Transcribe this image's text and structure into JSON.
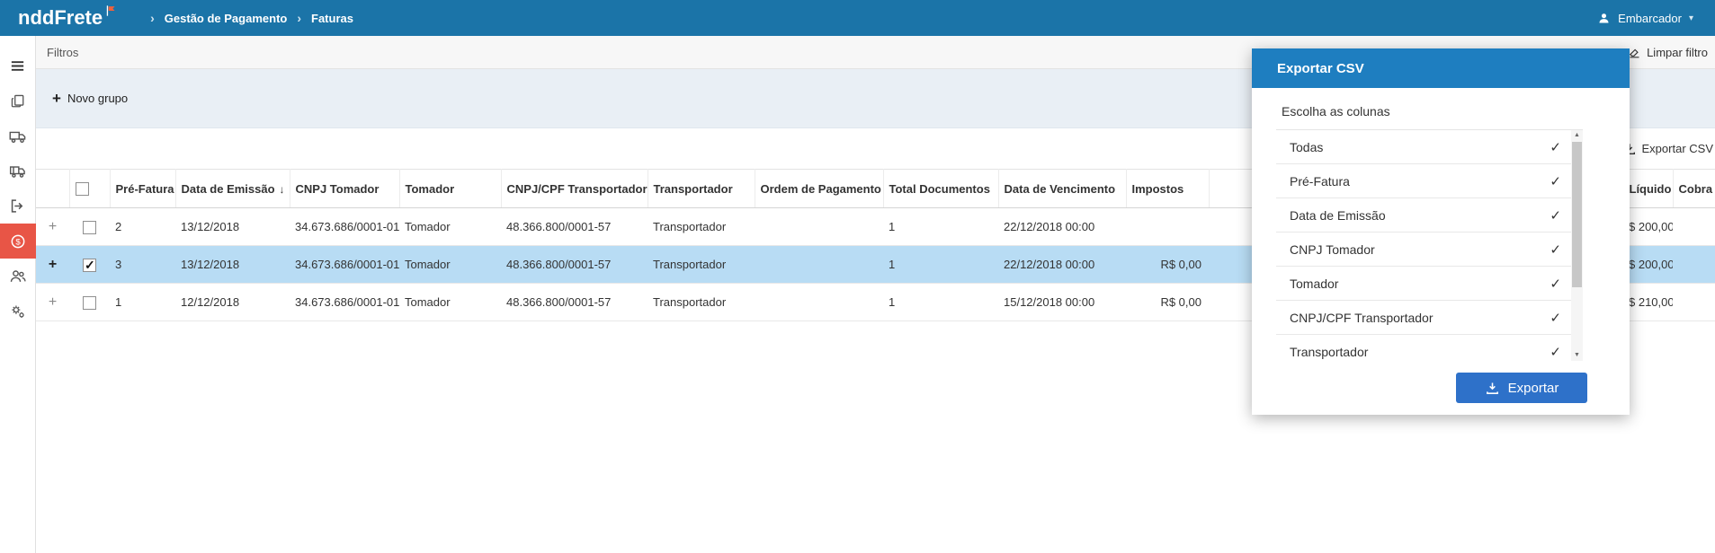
{
  "colors": {
    "topbar": "#1b74a8",
    "modal_header": "#1e7ec0",
    "primary_button": "#2e71c9",
    "selected_row": "#b8dcf4",
    "active_sidebar_item": "#e85546",
    "filter_area": "#e9eff5"
  },
  "icons": {
    "breadcrumb_chevron": "›",
    "caret_down": "▾",
    "sort_desc": "↓",
    "check": "✓",
    "plus": "+",
    "expand_plus": "+",
    "scroll_up": "▲",
    "scroll_down": "▼"
  },
  "topbar": {
    "logo_text": "nddFrete",
    "breadcrumb": [
      "Gestão de Pagamento",
      "Faturas"
    ],
    "user_label": "Embarcador"
  },
  "filters": {
    "title": "Filtros",
    "new_group": "Novo grupo",
    "clear_filter": "Limpar filtro",
    "export_csv": "Exportar CSV"
  },
  "table": {
    "headers": {
      "pre_fatura": "Pré-Fatura",
      "data_emissao": "Data de Emissão",
      "cnpj_tomador": "CNPJ Tomador",
      "tomador": "Tomador",
      "cnpj_transportador": "CNPJ/CPF Transportador",
      "transportador": "Transportador",
      "ordem_pagamento": "Ordem de Pagamento",
      "total_documentos": "Total Documentos",
      "data_vencimento": "Data de Vencimento",
      "impostos": "Impostos",
      "liquido": "Líquido",
      "cobranca": "Cobra"
    },
    "rows": [
      {
        "selected": false,
        "checked": false,
        "pre_fatura": "2",
        "data_emissao": "13/12/2018",
        "cnpj_tomador": "34.673.686/0001-01",
        "tomador": "Tomador",
        "cnpj_transportador": "48.366.800/0001-57",
        "transportador": "Transportador",
        "ordem_pagamento": "",
        "total_documentos": "1",
        "data_vencimento": "22/12/2018 00:00",
        "impostos": "",
        "liquido": "$ 200,00",
        "cobranca": ""
      },
      {
        "selected": true,
        "checked": true,
        "pre_fatura": "3",
        "data_emissao": "13/12/2018",
        "cnpj_tomador": "34.673.686/0001-01",
        "tomador": "Tomador",
        "cnpj_transportador": "48.366.800/0001-57",
        "transportador": "Transportador",
        "ordem_pagamento": "",
        "total_documentos": "1",
        "data_vencimento": "22/12/2018 00:00",
        "impostos": "R$ 0,00",
        "liquido": "$ 200,00",
        "cobranca": ""
      },
      {
        "selected": false,
        "checked": false,
        "pre_fatura": "1",
        "data_emissao": "12/12/2018",
        "cnpj_tomador": "34.673.686/0001-01",
        "tomador": "Tomador",
        "cnpj_transportador": "48.366.800/0001-57",
        "transportador": "Transportador",
        "ordem_pagamento": "",
        "total_documentos": "1",
        "data_vencimento": "15/12/2018 00:00",
        "impostos": "R$ 0,00",
        "liquido": "$ 210,00",
        "cobranca": ""
      }
    ]
  },
  "modal": {
    "title": "Exportar CSV",
    "subtitle": "Escolha as colunas",
    "columns": [
      {
        "label": "Todas",
        "checked": true
      },
      {
        "label": "Pré-Fatura",
        "checked": true
      },
      {
        "label": "Data de Emissão",
        "checked": true
      },
      {
        "label": "CNPJ Tomador",
        "checked": true
      },
      {
        "label": "Tomador",
        "checked": true
      },
      {
        "label": "CNPJ/CPF Transportador",
        "checked": true
      },
      {
        "label": "Transportador",
        "checked": true
      }
    ],
    "export_button": "Exportar"
  }
}
